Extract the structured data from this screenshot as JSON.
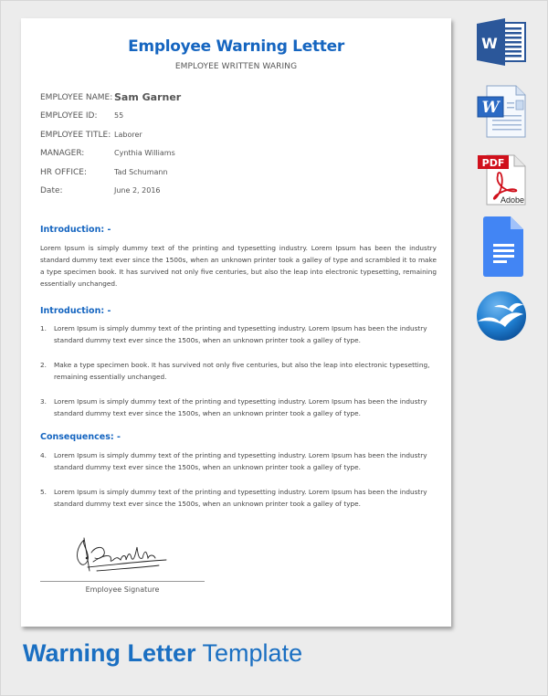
{
  "document": {
    "title": "Employee Warning Letter",
    "subtitle": "EMPLOYEE WRITTEN WARING",
    "details": [
      {
        "label": "EMPLOYEE NAME:",
        "value": "Sam Garner"
      },
      {
        "label": "EMPLOYEE ID:",
        "value": "55"
      },
      {
        "label": "EMPLOYEE TITLE:",
        "value": "Laborer"
      },
      {
        "label": "MANAGER:",
        "value": "Cynthia Williams"
      },
      {
        "label": "HR OFFICE:",
        "value": "Tad Schumann"
      },
      {
        "label": "Date:",
        "value": "June 2, 2016"
      }
    ],
    "sections": [
      {
        "heading": "Introduction: -",
        "paragraph": "Lorem Ipsum is simply dummy text of the printing and typesetting industry. Lorem Ipsum has been the industry standard dummy text ever since the 1500s, when an unknown printer took a galley of type and scrambled it to make a type specimen book. It has survived not only five centuries, but also the leap into electronic typesetting, remaining essentially unchanged."
      },
      {
        "heading": "Introduction: -",
        "items": [
          {
            "num": "1.",
            "text": "Lorem Ipsum is simply dummy text of the printing and typesetting industry. Lorem Ipsum has been the industry standard dummy text ever since the 1500s, when an unknown printer took a galley of type."
          },
          {
            "num": "2.",
            "text": "Make a type specimen book. It has survived not only five centuries, but also the leap into electronic typesetting, remaining essentially unchanged."
          },
          {
            "num": "3.",
            "text": "Lorem Ipsum is simply dummy text of the printing and typesetting industry. Lorem Ipsum has been the industry standard dummy text ever since the 1500s, when an unknown printer took a galley of type."
          }
        ]
      },
      {
        "heading": "Consequences: -",
        "items": [
          {
            "num": "4.",
            "text": "Lorem Ipsum is simply dummy text of the printing and typesetting industry. Lorem Ipsum has been the industry standard dummy text ever since the 1500s, when an unknown printer took a galley of type."
          },
          {
            "num": "5.",
            "text": "Lorem Ipsum is simply dummy text of the printing and typesetting industry. Lorem Ipsum has been the industry standard dummy text ever since the 1500s, when an unknown printer took a galley of type."
          }
        ]
      }
    ],
    "signature_label": "Employee Signature"
  },
  "footer": {
    "title_bold": "Warning Letter",
    "title_light": "Template"
  },
  "format_icons": [
    {
      "name": "ms-word-icon",
      "label": "W"
    },
    {
      "name": "word-document-icon",
      "label": "W"
    },
    {
      "name": "pdf-adobe-icon",
      "label": "PDF",
      "sublabel": "Adobe"
    },
    {
      "name": "google-docs-icon"
    },
    {
      "name": "openoffice-icon"
    }
  ],
  "colors": {
    "accent": "#1565c0",
    "background": "#ececec",
    "page": "#ffffff",
    "text": "#444444"
  }
}
